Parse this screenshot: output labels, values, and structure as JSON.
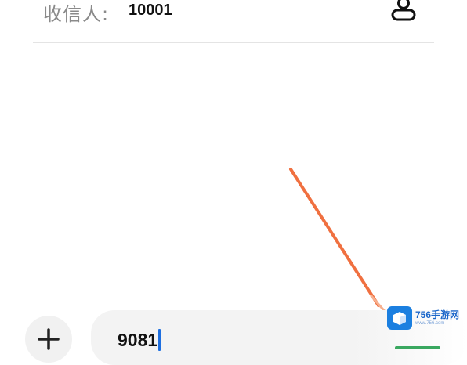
{
  "recipient": {
    "label": "收信人:",
    "value": "10001",
    "contact_icon": "contact-person-icon"
  },
  "composer": {
    "add_icon": "plus-icon",
    "message_text": "9081",
    "cursor_color": "#1e6fe0"
  },
  "annotation": {
    "arrow_color": "#f07040"
  },
  "watermark": {
    "brand": "756手游网",
    "url": "www.756.com",
    "logo_color": "#1b7fe0"
  }
}
